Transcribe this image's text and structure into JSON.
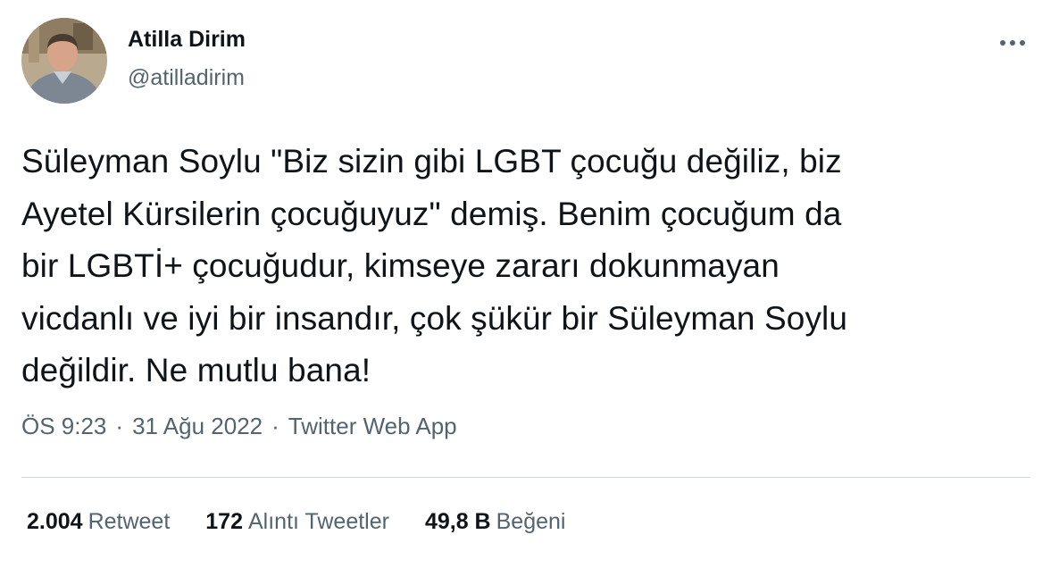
{
  "author": {
    "display_name": "Atilla Dirim",
    "handle": "@atilladirim",
    "avatar_icon": "profile-photo"
  },
  "menu_icon": "more-options-icon",
  "tweet": {
    "text": "Süleyman Soylu \"Biz sizin gibi LGBT çocuğu değiliz, biz\nAyetel Kürsilerin çocuğuyuz\" demiş. Benim çocuğum da\nbir LGBTİ+ çocuğudur, kimseye zararı dokunmayan\nvicdanlı ve iyi bir insandır, çok şükür bir Süleyman Soylu\ndeğildir. Ne mutlu bana!"
  },
  "meta": {
    "time": "ÖS 9:23",
    "separator": "·",
    "date": "31 Ağu 2022",
    "source": "Twitter Web App"
  },
  "stats": {
    "retweets": {
      "count": "2.004",
      "label": "Retweet"
    },
    "quotes": {
      "count": "172",
      "label": "Alıntı Tweetler"
    },
    "likes": {
      "count": "49,8 B",
      "label": "Beğeni"
    }
  },
  "colors": {
    "text": "#0f1419",
    "secondary": "#536471",
    "divider": "#cfd9de"
  }
}
